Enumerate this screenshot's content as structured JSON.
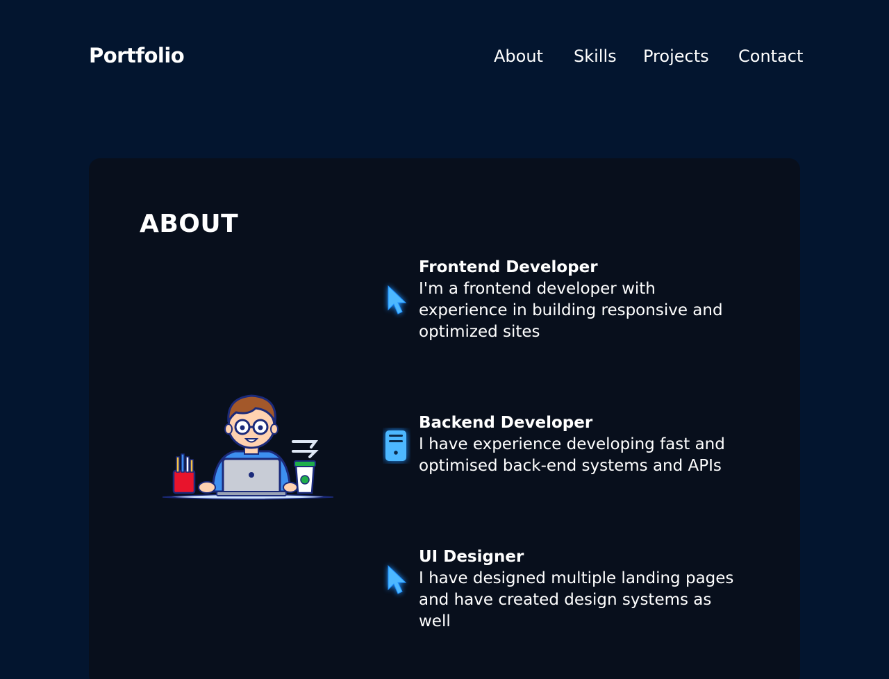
{
  "header": {
    "logo": "Portfolio",
    "nav": [
      "About",
      "Skills",
      "Projects",
      "Contact"
    ]
  },
  "about": {
    "title": "ABOUT",
    "items": [
      {
        "title": "Frontend Developer",
        "description": "I'm a frontend developer with experience in building responsive and optimized sites",
        "icon": "cursor-icon"
      },
      {
        "title": "Backend Developer",
        "description": "I have experience developing fast and optimised back-end systems and APIs",
        "icon": "server-icon"
      },
      {
        "title": "UI Designer",
        "description": "I have designed multiple landing pages and have created design systems as well",
        "icon": "cursor-icon"
      }
    ]
  },
  "colors": {
    "page_background": "#03152f",
    "card_background": "#080f1c",
    "icon_accent": "#4db8ff",
    "text": "#ffffff"
  }
}
